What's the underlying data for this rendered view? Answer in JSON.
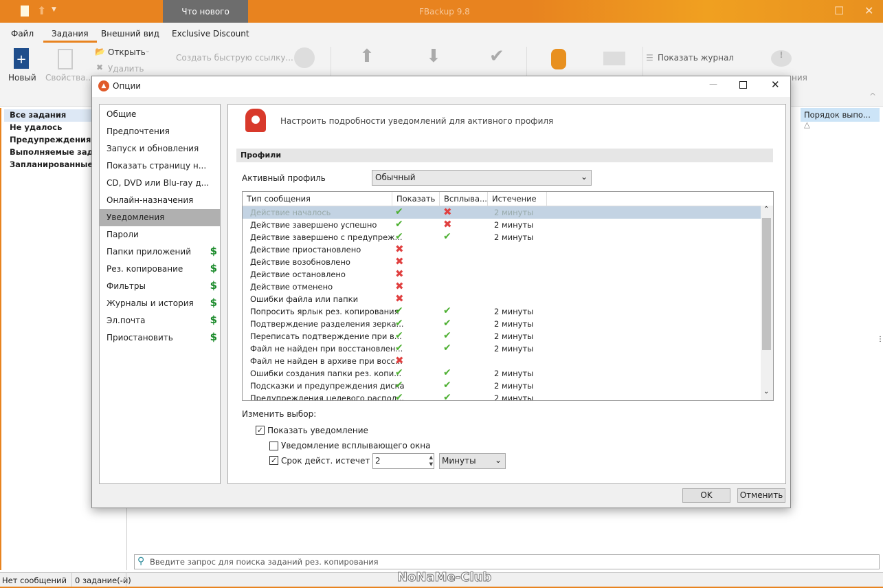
{
  "app": {
    "title": "FBackup 9.8",
    "whats_new": "Что нового"
  },
  "menu": [
    "Файл",
    "Задания",
    "Внешний вид",
    "Exclusive Discount"
  ],
  "ribbon": {
    "new": "Новый",
    "properties": "Свойства...",
    "open": "Открыть",
    "delete": "Удалить",
    "quick_link": "Создать быструю ссылку...",
    "show_log": "Показать журнал",
    "partial": "ния"
  },
  "left_panel": [
    "Все задания",
    "Не удалось",
    "Предупреждения",
    "Выполняемые задан",
    "Запланированные"
  ],
  "column_header": "Порядок выпо...",
  "search_placeholder": "Введите запрос для поиска заданий рез. копирования",
  "status": {
    "messages": "Нет сообщений",
    "jobs": "0 задание(-й)"
  },
  "watermark": "NoNaMe-Club",
  "dialog": {
    "title": "Опции",
    "nav": [
      {
        "label": "Общие"
      },
      {
        "label": "Предпочтения"
      },
      {
        "label": "Запуск и обновления"
      },
      {
        "label": "Показать страницу н..."
      },
      {
        "label": "CD, DVD или Blu-ray д..."
      },
      {
        "label": "Онлайн-назначения"
      },
      {
        "label": "Уведомления",
        "selected": true
      },
      {
        "label": "Пароли"
      },
      {
        "label": "Папки приложений",
        "paid": "$"
      },
      {
        "label": "Рез. копирование",
        "paid": "$"
      },
      {
        "label": "Фильтры",
        "paid": "$"
      },
      {
        "label": "Журналы и история",
        "paid": "$"
      },
      {
        "label": "Эл.почта",
        "paid": "$"
      },
      {
        "label": "Приостановить",
        "paid": "$"
      }
    ],
    "header": "Настроить подробности уведомлений для активного профиля",
    "section": "Профили",
    "active_profile_label": "Активный профиль",
    "active_profile": "Обычный",
    "columns": [
      "Тип сообщения",
      "Показать",
      "Всплыва...",
      "Истечение ..."
    ],
    "rows": [
      {
        "type": "Действие началось",
        "show": true,
        "popup": false,
        "expire": "2 минуты",
        "selected": true
      },
      {
        "type": "Действие завершено успешно",
        "show": true,
        "popup": false,
        "expire": "2 минуты"
      },
      {
        "type": "Действие завершено с предупреж...",
        "show": true,
        "popup": true,
        "expire": "2 минуты"
      },
      {
        "type": "Действие приостановлено",
        "show": false
      },
      {
        "type": "Действие возобновлено",
        "show": false
      },
      {
        "type": "Действие остановлено",
        "show": false
      },
      {
        "type": "Действие отменено",
        "show": false
      },
      {
        "type": "Ошибки файла или папки",
        "show": false
      },
      {
        "type": "Попросить ярлык рез. копирования",
        "show": true,
        "popup": true,
        "expire": "2 минуты"
      },
      {
        "type": "Подтверждение разделения зерка...",
        "show": true,
        "popup": true,
        "expire": "2 минуты"
      },
      {
        "type": "Переписать подтверждение при в...",
        "show": true,
        "popup": true,
        "expire": "2 минуты"
      },
      {
        "type": "Файл не найден при восстановлен...",
        "show": true,
        "popup": true,
        "expire": "2 минуты"
      },
      {
        "type": "Файл не найден в архиве при восс...",
        "show": false
      },
      {
        "type": "Ошибки создания папки рез. копи...",
        "show": true,
        "popup": true,
        "expire": "2 минуты"
      },
      {
        "type": "Подсказки и предупреждения диска",
        "show": true,
        "popup": true,
        "expire": "2 минуты"
      },
      {
        "type": "Предупреждения целевого распол...",
        "show": true,
        "popup": true,
        "expire": "2 минуты"
      }
    ],
    "change_label": "Изменить выбор:",
    "show_notification": {
      "label": "Показать уведомление",
      "checked": true
    },
    "popup_notification": {
      "label": "Уведомление всплывающего окна",
      "checked": false
    },
    "expire": {
      "label": "Срок дейст. истечет ч-з",
      "checked": true,
      "value": "2",
      "unit": "Минуты"
    },
    "ok": "OK",
    "cancel": "Отменить"
  },
  "colors": {
    "accent": "#e8831f",
    "ok": "#4caf30",
    "no": "#e04040",
    "paid": "#1a8a2a"
  }
}
